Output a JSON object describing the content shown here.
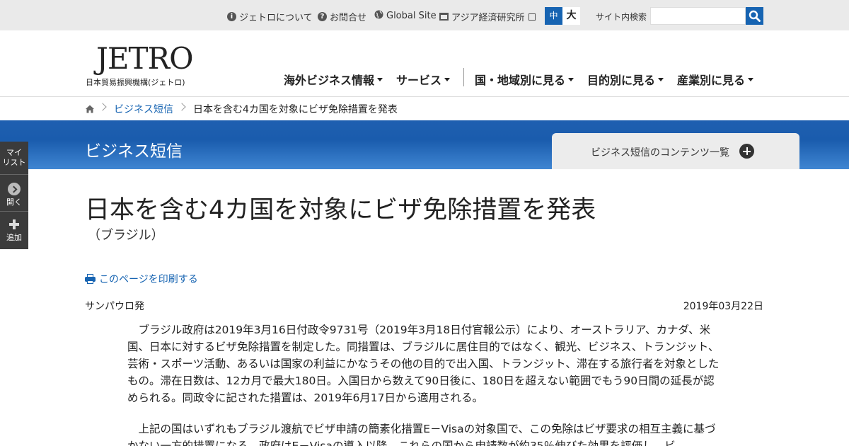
{
  "utility_nav": {
    "about_label": "ジェトロについて",
    "contact_label": "お問合せ",
    "global_label": "Global Site",
    "ide_label": "アジア経済研究所",
    "font_mid_label": "中",
    "font_large_label": "大",
    "search_label": "サイト内検索",
    "search_value": ""
  },
  "logo": {
    "mark": "JETRO",
    "subtitle": "日本貿易振興機構(ジェトロ)"
  },
  "main_nav": {
    "items": [
      {
        "label": "海外ビジネス情報"
      },
      {
        "label": "サービス"
      },
      {
        "label": "国・地域別に見る"
      },
      {
        "label": "目的別に見る"
      },
      {
        "label": "産業別に見る"
      }
    ]
  },
  "breadcrumb": {
    "section": "ビジネス短信",
    "current": "日本を含む4カ国を対象にビザ免除措置を発表"
  },
  "section_band": {
    "title": "ビジネス短信",
    "contents_label": "ビジネス短信のコンテンツ一覧"
  },
  "side_tool": {
    "mylist_label": "マイ\nリスト",
    "open_label": "開く",
    "add_label": "追加"
  },
  "article": {
    "title": "日本を含む4カ国を対象にビザ免除措置を発表",
    "region": "（ブラジル）",
    "print_label": "このページを印刷する",
    "dateline": "サンパウロ発",
    "date": "2019年03月22日",
    "paragraphs": [
      "ブラジル政府は2019年3月16日付政令9731号（2019年3月18日付官報公示）により、オーストラリア、カナダ、米国、日本に対するビザ免除措置を制定した。同措置は、ブラジルに居住目的ではなく、観光、ビジネス、トランジット、芸術・スポーツ活動、あるいは国家の利益にかなうその他の目的で出入国、トランジット、滞在する旅行者を対象としたもの。滞在日数は、12カ月で最大180日。入国日から数えて90日後に、180日を超えない範囲でもう90日間の延長が認められる。同政令に記された措置は、2019年6月17日から適用される。",
      "上記の国はいずれもブラジル渡航でビザ申請の簡素化措置E－Visaの対象国で、この免除はビザ要求の相互主義に基づかない一方的措置になる。政府はE－Visaの導入以降、これらの国から申請数が約35％伸びた効果を評価し、ビ"
    ]
  }
}
